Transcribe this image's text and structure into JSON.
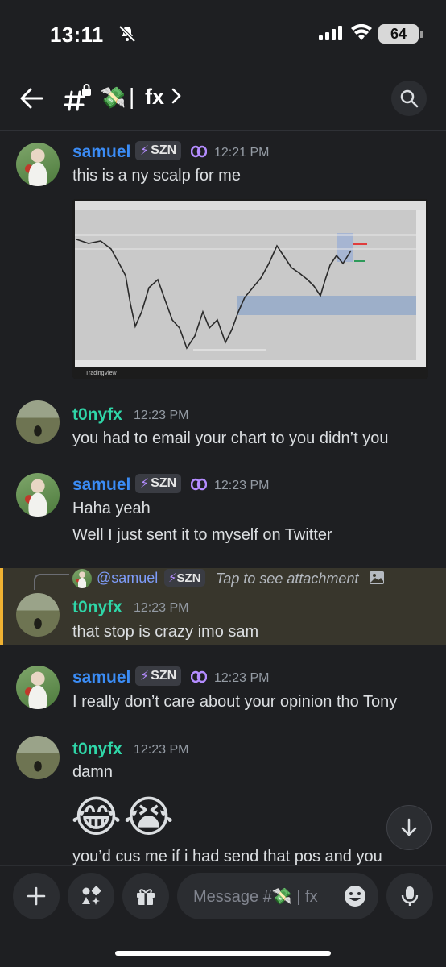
{
  "status_bar": {
    "time": "13:11",
    "battery": "64"
  },
  "header": {
    "channel_emoji": "💸",
    "separator": "|",
    "channel_name": "fx"
  },
  "messages": [
    {
      "author": "samuel",
      "tag": "SZN",
      "timestamp": "12:21 PM",
      "lines": [
        "this is a ny scalp for me"
      ],
      "attachment_caption": "TradingView"
    },
    {
      "author": "t0nyfx",
      "timestamp": "12:23 PM",
      "lines": [
        "you had to email your chart to you didn’t you"
      ]
    },
    {
      "author": "samuel",
      "tag": "SZN",
      "timestamp": "12:23 PM",
      "lines": [
        "Haha yeah",
        "Well I just sent it to myself on Twitter"
      ]
    },
    {
      "author": "t0nyfx",
      "timestamp": "12:23 PM",
      "lines": [
        "that stop is crazy imo sam"
      ],
      "reply": {
        "user": "@samuel",
        "tag": "SZN",
        "text": "Tap to see attachment"
      }
    },
    {
      "author": "samuel",
      "tag": "SZN",
      "timestamp": "12:23 PM",
      "lines": [
        "I really don’t care about your opinion tho Tony"
      ]
    },
    {
      "author": "t0nyfx",
      "timestamp": "12:23 PM",
      "lines": [
        "damn",
        "😂😭",
        "you’d cus me if i had send that pos and you"
      ]
    }
  ],
  "composer": {
    "placeholder": "Message #💸 | fx"
  },
  "colors": {
    "background": "#1e1f22",
    "samuel": "#3b8cf5",
    "tony": "#2fd6a8",
    "reply_highlight": "#f0b232",
    "timestamp": "#949ba4"
  },
  "icons": [
    "mute-bell-icon",
    "signal-icon",
    "wifi-icon",
    "back-arrow-icon",
    "hash-lock-icon",
    "search-icon",
    "bolt-icon",
    "nitro-boost-icon",
    "image-icon",
    "arrow-down-icon",
    "plus-icon",
    "apps-icon",
    "gift-icon",
    "emoji-icon",
    "microphone-icon"
  ]
}
